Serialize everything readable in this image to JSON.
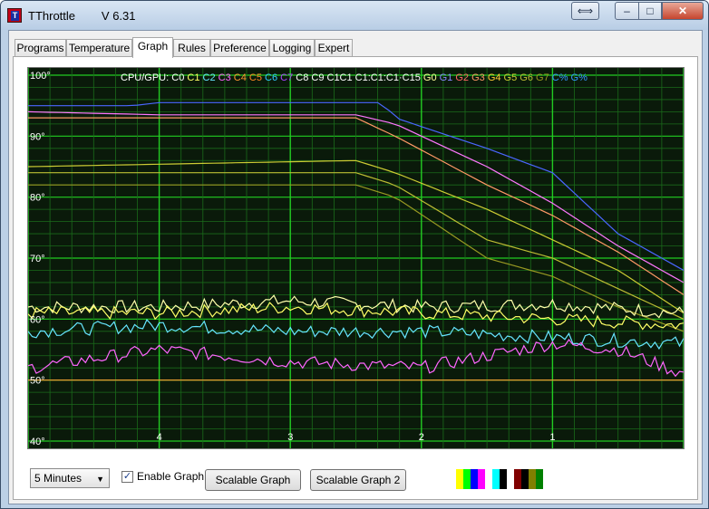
{
  "window": {
    "title": "TThrottle",
    "version": "V 6.31",
    "buttons": {
      "swap": "⟺",
      "minimize": "‒",
      "maximize": "□",
      "close": "✕"
    }
  },
  "tabs": [
    {
      "label": "Programs",
      "active": false
    },
    {
      "label": "Temperature",
      "active": false
    },
    {
      "label": "Graph",
      "active": true
    },
    {
      "label": "Rules",
      "active": false
    },
    {
      "label": "Preference",
      "active": false
    },
    {
      "label": "Logging",
      "active": false
    },
    {
      "label": "Expert",
      "active": false
    }
  ],
  "legend": [
    {
      "text": "CPU/GPU:",
      "color": "#ffffff"
    },
    {
      "text": "C0",
      "color": "#ffffff"
    },
    {
      "text": "C1",
      "color": "#ffff66"
    },
    {
      "text": "C2",
      "color": "#66e6ff"
    },
    {
      "text": "C3",
      "color": "#ff66ff"
    },
    {
      "text": "C4",
      "color": "#ff9933"
    },
    {
      "text": "C5",
      "color": "#ff8822"
    },
    {
      "text": "C6",
      "color": "#33ccff"
    },
    {
      "text": "C7",
      "color": "#aa44ff"
    },
    {
      "text": "C8",
      "color": "#ffffff"
    },
    {
      "text": "C9",
      "color": "#ffffff"
    },
    {
      "text": "C1C1",
      "color": "#ffffff"
    },
    {
      "text": "C1:C1:C1·C15",
      "color": "#ffffff"
    },
    {
      "text": "G0",
      "color": "#ffff99"
    },
    {
      "text": "G1",
      "color": "#8888ff"
    },
    {
      "text": "G2",
      "color": "#ff6666"
    },
    {
      "text": "G3",
      "color": "#ff9966"
    },
    {
      "text": "G4",
      "color": "#ffcc33"
    },
    {
      "text": "G5",
      "color": "#cccc33"
    },
    {
      "text": "G6",
      "color": "#bbbb33"
    },
    {
      "text": "G7",
      "color": "#999922"
    },
    {
      "text": "C%",
      "color": "#3399ff"
    },
    {
      "text": "G%",
      "color": "#3399ff"
    }
  ],
  "axes": {
    "y_labels": [
      "100°",
      "90°",
      "80°",
      "70°",
      "60°",
      "50°",
      "40°"
    ],
    "x_labels": [
      "4",
      "3",
      "2",
      "1"
    ]
  },
  "controls": {
    "duration": "5 Minutes",
    "enable_graph_label": "Enable Graph",
    "enable_graph_checked": true,
    "scalable_graph_label": "Scalable Graph",
    "scalable_graph2_label": "Scalable Graph 2"
  },
  "swatch_colors": [
    "#ffff00",
    "#00ff00",
    "#0000ff",
    "#ff00ff",
    "#ffffff",
    "#00ffff",
    "#000000",
    "#ffffff",
    "#800000",
    "#000000",
    "#808000",
    "#008000"
  ],
  "colors": {
    "graph_bg": "#0a1a0a",
    "grid_major": "#22cc22",
    "grid_minor": "#1a6a1a"
  },
  "chart_data": {
    "type": "line",
    "y_range": [
      40,
      100
    ],
    "x_range_minutes": [
      5,
      0
    ],
    "series_approx": [
      {
        "color": "#4a66ff",
        "points": [
          [
            5,
            95
          ],
          [
            4.2,
            95
          ],
          [
            4,
            95.5
          ],
          [
            2.3,
            95.5
          ],
          [
            2.2,
            93
          ],
          [
            1.5,
            88
          ],
          [
            1,
            84
          ],
          [
            0.5,
            74
          ],
          [
            0,
            68
          ]
        ]
      },
      {
        "color": "#ff77ff",
        "points": [
          [
            5,
            94
          ],
          [
            4,
            93.5
          ],
          [
            2.5,
            93.5
          ],
          [
            2.2,
            92
          ],
          [
            1.5,
            85
          ],
          [
            1,
            79
          ],
          [
            0.5,
            72
          ],
          [
            0,
            66
          ]
        ]
      },
      {
        "color": "#ff9966",
        "points": [
          [
            5,
            93
          ],
          [
            2.5,
            93
          ],
          [
            2.2,
            90
          ],
          [
            1.5,
            82
          ],
          [
            1,
            77
          ],
          [
            0.5,
            71
          ],
          [
            0,
            64
          ]
        ]
      },
      {
        "color": "#cccc33",
        "points": [
          [
            5,
            85
          ],
          [
            2.5,
            86
          ],
          [
            2.2,
            84
          ],
          [
            1.5,
            78
          ],
          [
            1,
            73
          ],
          [
            0.5,
            68
          ],
          [
            0,
            61
          ]
        ]
      },
      {
        "color": "#bbbb33",
        "points": [
          [
            5,
            84
          ],
          [
            2.5,
            84
          ],
          [
            2.2,
            82
          ],
          [
            1.5,
            73
          ],
          [
            1,
            70
          ],
          [
            0.5,
            65
          ],
          [
            0,
            60
          ]
        ]
      },
      {
        "color": "#999922",
        "points": [
          [
            5,
            82
          ],
          [
            2.5,
            82
          ],
          [
            2.2,
            80
          ],
          [
            1.5,
            70
          ],
          [
            1,
            67
          ],
          [
            0.5,
            62
          ],
          [
            0,
            58
          ]
        ]
      },
      {
        "color": "#ffffaa",
        "points": [
          [
            5,
            62
          ],
          [
            4,
            62
          ],
          [
            3,
            63
          ],
          [
            2,
            62
          ],
          [
            1,
            62.5
          ],
          [
            0,
            61
          ]
        ]
      },
      {
        "color": "#ffff66",
        "points": [
          [
            5,
            61
          ],
          [
            4,
            61
          ],
          [
            3,
            62
          ],
          [
            2,
            61
          ],
          [
            1,
            60
          ],
          [
            0,
            59
          ]
        ]
      },
      {
        "color": "#66e6ff",
        "points": [
          [
            5,
            58
          ],
          [
            4,
            59
          ],
          [
            3,
            58
          ],
          [
            2,
            58
          ],
          [
            1,
            57
          ],
          [
            0,
            56
          ]
        ]
      },
      {
        "color": "#ff66ff",
        "points": [
          [
            5,
            52
          ],
          [
            4,
            55
          ],
          [
            3,
            53
          ],
          [
            2,
            52
          ],
          [
            1,
            56
          ],
          [
            0.5,
            55
          ],
          [
            0,
            51
          ]
        ]
      },
      {
        "color": "#ff9933",
        "points": [
          [
            5,
            50
          ],
          [
            0,
            50
          ]
        ]
      }
    ]
  }
}
